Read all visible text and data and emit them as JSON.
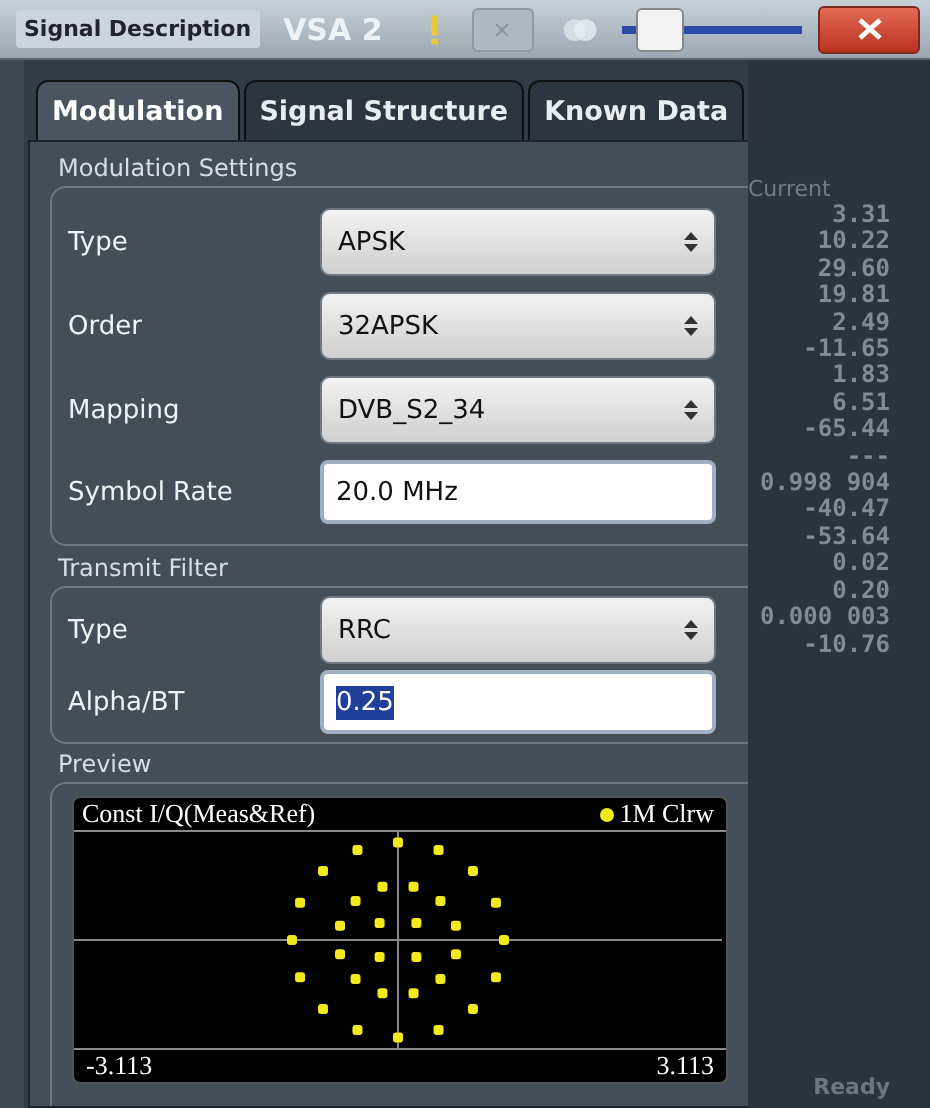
{
  "title_bar": {
    "dialog_title": "Signal Description",
    "channel": "VSA 2",
    "transparency_slider": {
      "level": 0.1
    }
  },
  "tabs": [
    {
      "label": "Modulation",
      "selected": true
    },
    {
      "label": "Signal Structure",
      "selected": false
    },
    {
      "label": "Known Data",
      "selected": false
    }
  ],
  "modulation_settings": {
    "title": "Modulation Settings",
    "fields": [
      {
        "label": "Type",
        "kind": "select",
        "value": "APSK"
      },
      {
        "label": "Order",
        "kind": "select",
        "value": "32APSK"
      },
      {
        "label": "Mapping",
        "kind": "select",
        "value": "DVB_S2_34"
      },
      {
        "label": "Symbol Rate",
        "kind": "input",
        "value": "20.0 MHz",
        "highlighted": false
      }
    ]
  },
  "transmit_filter": {
    "title": "Transmit Filter",
    "fields": [
      {
        "label": "Type",
        "kind": "select",
        "value": "RRC"
      },
      {
        "label": "Alpha/BT",
        "kind": "input",
        "value": "0.25",
        "highlighted": true
      }
    ]
  },
  "preview": {
    "title": "Preview",
    "chart_title": "Const I/Q(Meas&Ref)",
    "trace": "1M Clrw",
    "x_min": "-3.113",
    "x_max": "3.113"
  },
  "background": {
    "column_header": "Current",
    "values": [
      "3.31",
      "10.22",
      "29.60",
      "19.81",
      "2.49",
      "-11.65",
      "1.83",
      "6.51",
      "-65.44",
      "---",
      "0.998 904",
      "-40.47",
      "-53.64",
      "0.02",
      "0.20",
      "0.000 003",
      "-10.76"
    ],
    "status": "Ready"
  }
}
